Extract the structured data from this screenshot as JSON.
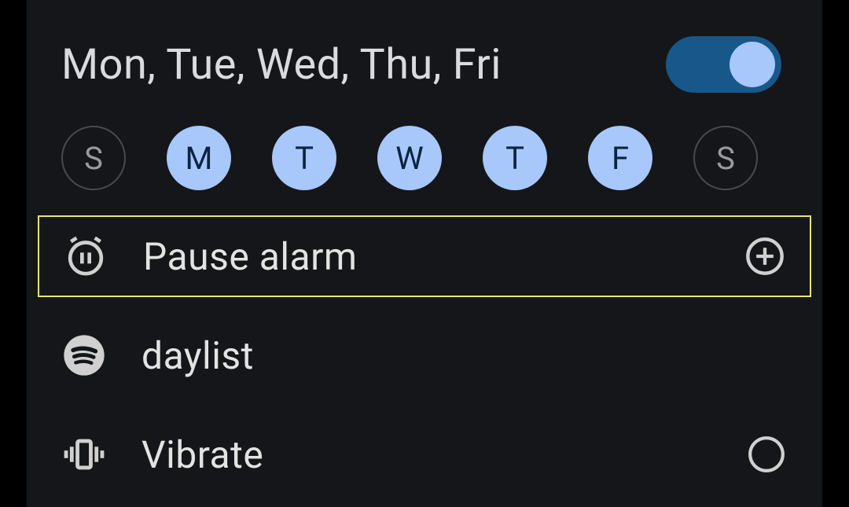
{
  "schedule": {
    "label": "Mon, Tue, Wed, Thu, Fri",
    "enabled": true
  },
  "days": [
    {
      "letter": "S",
      "active": false
    },
    {
      "letter": "M",
      "active": true
    },
    {
      "letter": "T",
      "active": true
    },
    {
      "letter": "W",
      "active": true
    },
    {
      "letter": "T",
      "active": true
    },
    {
      "letter": "F",
      "active": true
    },
    {
      "letter": "S",
      "active": false
    }
  ],
  "options": {
    "pause": {
      "label": "Pause alarm"
    },
    "sound": {
      "label": "daylist"
    },
    "vibrate": {
      "label": "Vibrate",
      "checked": false
    }
  }
}
